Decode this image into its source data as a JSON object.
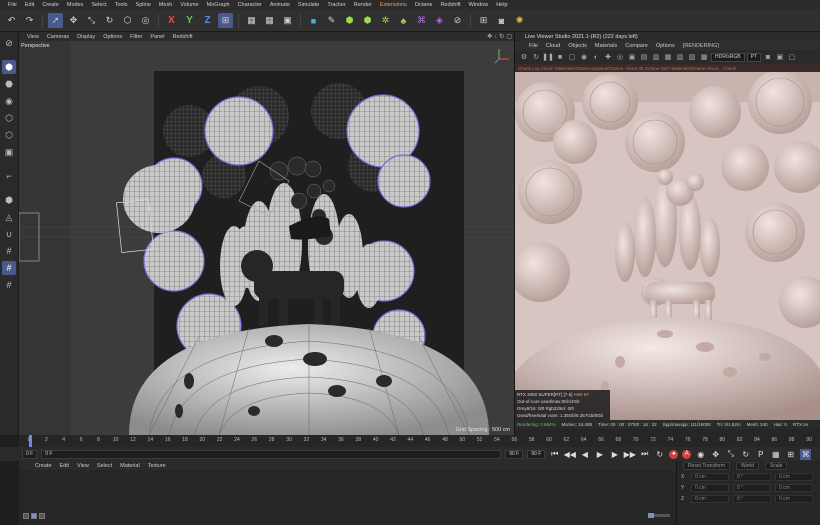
{
  "menubar": [
    "File",
    "Edit",
    "Create",
    "Modes",
    "Select",
    "Tools",
    "Spline",
    "Mesh",
    "Volume",
    "MoGraph",
    "Character",
    "Animate",
    "Simulate",
    "Tracker",
    "Render",
    "Extensions",
    "Octane",
    "Redshift",
    "Window",
    "Help"
  ],
  "toolbar": {
    "axis_x": "X",
    "axis_y": "Y",
    "axis_z": "Z"
  },
  "viewport": {
    "menu": [
      "View",
      "Cameras",
      "Display",
      "Options",
      "Filter",
      "Panel",
      "Redshift"
    ],
    "label": "Perspective",
    "grid_spacing": "Grid Spacing : 500 cm"
  },
  "liveviewer": {
    "title": "Live Viewer Studio 2021.1-(R2) (222 days left)",
    "menu": [
      "File",
      "Cloud",
      "Objects",
      "Materials",
      "Compare",
      "Options"
    ],
    "status": "[RENDERING]",
    "colorspace": "HDR/sRGB",
    "channel": "PT",
    "info_warning": "Check Log Cloud: Materials/Octane Updated/Octane. About 35 Octane Get? Materials/Octane About... Check",
    "stats": [
      {
        "label": "RTX 2060 SUPER[RT] [7.5]",
        "value": "%99",
        "value2": "67"
      },
      {
        "label": "Out-of-core used/max:0Kb/4Gb",
        "value": "",
        "value2": ""
      },
      {
        "label": "Grey8/16: 0/0",
        "value": "Rgb32/64: 0/0",
        "value2": ""
      },
      {
        "label": "Used/free/total vram: 1.35Gb/6.357Gb/8Gb",
        "value": "",
        "value2": ""
      }
    ],
    "bottom": {
      "rendering": "Rendering: 0.694%",
      "mssec": "Ms/sec: 24.488",
      "time": "Time: 00 : 00 : 07/00 : 16 : 22",
      "spp": "Spp/maxspp: 111/16000",
      "tri": "Tri: 0/1.52m",
      "mesh": "Mesh: 240",
      "hair": "Hair: 0",
      "rtx": "RTX:on"
    }
  },
  "timeline": {
    "ticks": [
      "0",
      "2",
      "4",
      "6",
      "8",
      "10",
      "12",
      "14",
      "16",
      "18",
      "20",
      "22",
      "24",
      "26",
      "28",
      "30",
      "32",
      "34",
      "36",
      "38",
      "40",
      "42",
      "44",
      "46",
      "48",
      "50",
      "52",
      "54",
      "56",
      "58",
      "60",
      "62",
      "64",
      "66",
      "68",
      "70",
      "72",
      "74",
      "76",
      "78",
      "80",
      "82",
      "84",
      "86",
      "88",
      "90"
    ],
    "current_frame": 0
  },
  "transport": {
    "start_field": "0 F",
    "current_field": "0 F",
    "end_field": "90 F",
    "end_field2": "90 F"
  },
  "material_manager": {
    "menu": [
      "Create",
      "Edit",
      "View",
      "Select",
      "Material",
      "Texture"
    ]
  },
  "coordinates": {
    "head": [
      "Reset Transform",
      "World",
      "Scale"
    ],
    "rows": [
      {
        "axis": "X",
        "v1": "0 cm",
        "v2": "0 °",
        "v3": "0 cm"
      },
      {
        "axis": "Y",
        "v1": "0 cm",
        "v2": "0 °",
        "v3": "0 cm"
      },
      {
        "axis": "Z",
        "v1": "0 cm",
        "v2": "0 °",
        "v3": "0 cm"
      }
    ]
  }
}
